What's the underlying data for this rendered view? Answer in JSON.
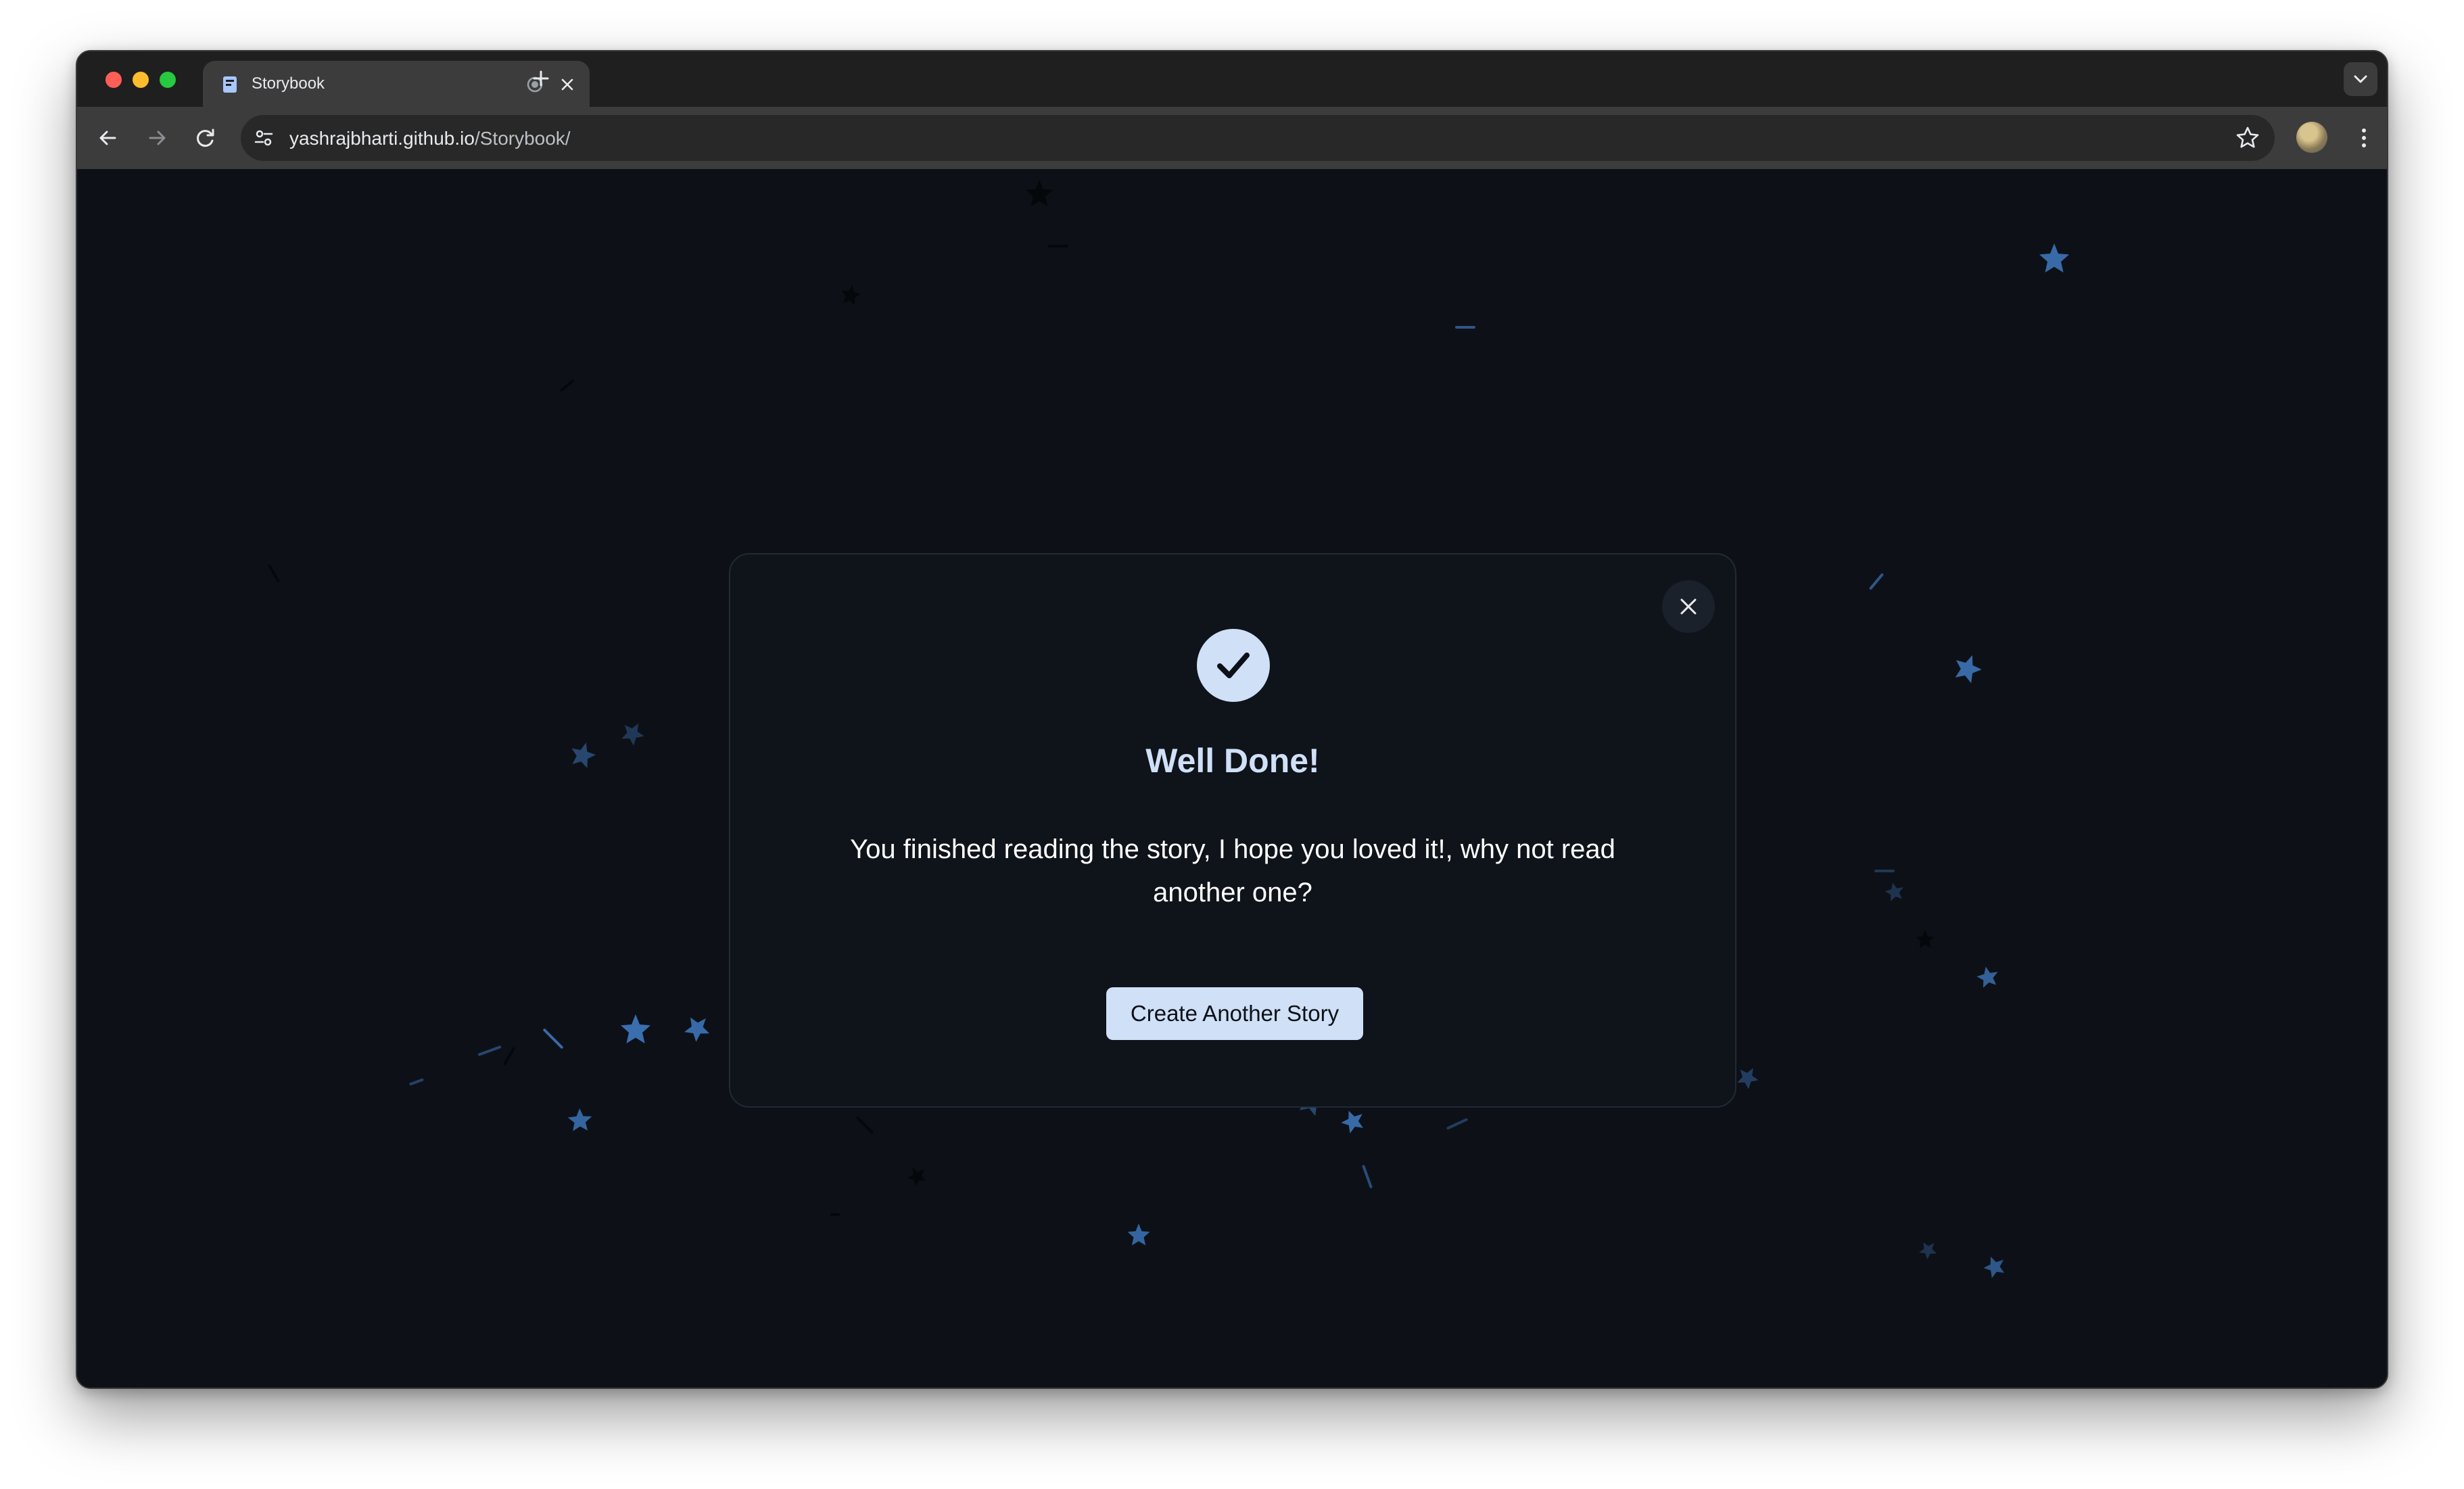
{
  "browser": {
    "tab": {
      "title": "Storybook"
    },
    "url": {
      "domain": "yashrajbharti.github.io",
      "path": "/Storybook/"
    }
  },
  "modal": {
    "title": "Well Done!",
    "message": "You finished reading the story, I hope you loved it!, why not read another one?",
    "primary_button": "Create Another Story",
    "close_icon": "close-icon",
    "status_icon": "check-icon"
  },
  "colors": {
    "page_background": "#0d1117",
    "accent": "#cfe0f7",
    "confetti_blue": "#3d74b8",
    "confetti_dark": "#05070a"
  }
}
